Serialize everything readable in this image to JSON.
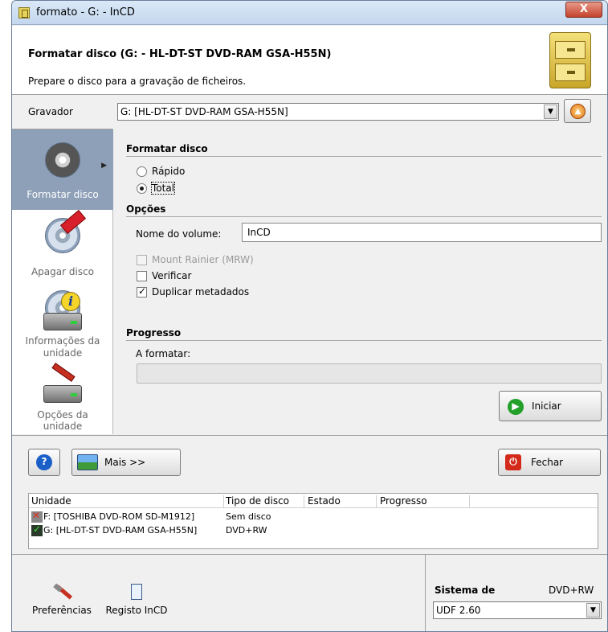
{
  "window": {
    "title": "formato - G: - InCD",
    "close_label": "X"
  },
  "header": {
    "title": "Formatar disco (G: - HL-DT-ST DVD-RAM GSA-H55N)",
    "subtitle": "Prepare o disco para a gravação de ficheiros."
  },
  "recorder": {
    "label": "Gravador",
    "value": "G: [HL-DT-ST DVD-RAM GSA-H55N]"
  },
  "sidebar": {
    "items": [
      {
        "label": "Formatar disco",
        "active": true
      },
      {
        "label": "Apagar disco",
        "active": false
      },
      {
        "label_line1": "Informações da",
        "label_line2": "unidade",
        "active": false
      },
      {
        "label_line1": "Opções da",
        "label_line2": "unidade",
        "active": false
      }
    ]
  },
  "format": {
    "section_title": "Formatar disco",
    "option_quick": "Rápido",
    "option_full": "Total",
    "selected": "Total"
  },
  "options": {
    "section_title": "Opções",
    "volume_label": "Nome do volume:",
    "volume_value": "InCD",
    "mount_rainier": "Mount Rainier (MRW)",
    "verify": "Verificar",
    "duplicate_metadata": "Duplicar metadados",
    "mount_rainier_checked": false,
    "verify_checked": false,
    "duplicate_metadata_checked": true
  },
  "progress": {
    "section_title": "Progresso",
    "status_label": "A formatar:",
    "value": 0
  },
  "buttons": {
    "start": "Iniciar",
    "more": "Mais >>",
    "close": "Fechar",
    "help_icon": "?"
  },
  "drive_list": {
    "columns": [
      "Unidade",
      "Tipo de disco",
      "Estado",
      "Progresso"
    ],
    "rows": [
      {
        "unit": "F: [TOSHIBA DVD-ROM SD-M1912]",
        "disc_type": "Sem disco",
        "state": "",
        "progress": "",
        "status_icon": "error-icon"
      },
      {
        "unit": "G: [HL-DT-ST DVD-RAM GSA-H55N]",
        "disc_type": "DVD+RW",
        "state": "",
        "progress": "",
        "status_icon": "ok-icon"
      }
    ]
  },
  "footer": {
    "preferences": "Preferências",
    "log": "Registo InCD",
    "filesystem_label": "Sistema de",
    "disc_type": "DVD+RW",
    "filesystem_value": "UDF 2.60"
  },
  "colors": {
    "sidebar_active": "#8ea0b8",
    "start_icon": "#22a02a",
    "close_icon": "#d42a1a",
    "help_icon": "#1a5fc8"
  }
}
